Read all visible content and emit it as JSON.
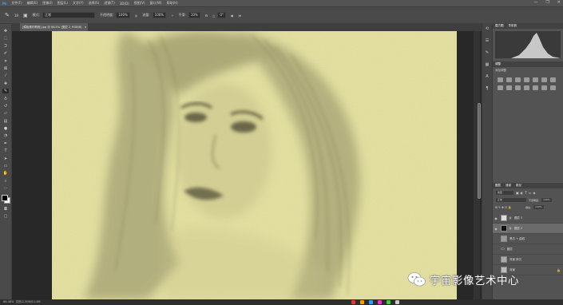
{
  "menubar": {
    "items": [
      "文件(F)",
      "编辑(E)",
      "图像(I)",
      "图层(L)",
      "文字(Y)",
      "选择(S)",
      "滤镜(T)",
      "3D(D)",
      "视图(V)",
      "窗口(W)",
      "帮助(H)"
    ],
    "win_controls": [
      "—",
      "❐",
      "✕"
    ]
  },
  "options": {
    "size_value": "19",
    "mode_label": "模式:",
    "mode_value": "正常",
    "opacity_label": "不透明度:",
    "opacity_value": "100%",
    "flow_label": "流量:",
    "flow_value": "100%",
    "smooth_label": "平滑:",
    "smooth_value": "10%",
    "angle_value": "0°"
  },
  "document": {
    "tab_label": "[模板素材教程].jpg @ 66.5% (图层 2, RGB/8)",
    "tab_close": "×"
  },
  "status": {
    "zoom": "66.48%",
    "doc_info": "文档:2.30M/11.4M"
  },
  "panels": {
    "histogram": {
      "tabs": [
        "直方图",
        "导航器"
      ]
    },
    "adjust": {
      "tabs": [
        "调整"
      ],
      "subtitle": "添加调整"
    },
    "layers": {
      "tabs": [
        "图层",
        "通道",
        "路径"
      ],
      "kind_label": "类型",
      "blend_mode": "正常",
      "opacity_label": "不透明度:",
      "opacity_value": "100%",
      "fill_label": "填充:",
      "fill_value": "100%",
      "items": [
        {
          "name": "图层 3"
        },
        {
          "name": "图层 2"
        },
        {
          "name": "黑白 + 曲线"
        },
        {
          "name": "图层"
        },
        {
          "name": "背景 拷贝"
        },
        {
          "name": "背景"
        }
      ]
    }
  },
  "watermark": {
    "text": "宇宙影像艺术中心"
  },
  "colors": {
    "canvas": "#e5e2a3",
    "workspace": "#282828",
    "ui_bg": "#535353"
  }
}
